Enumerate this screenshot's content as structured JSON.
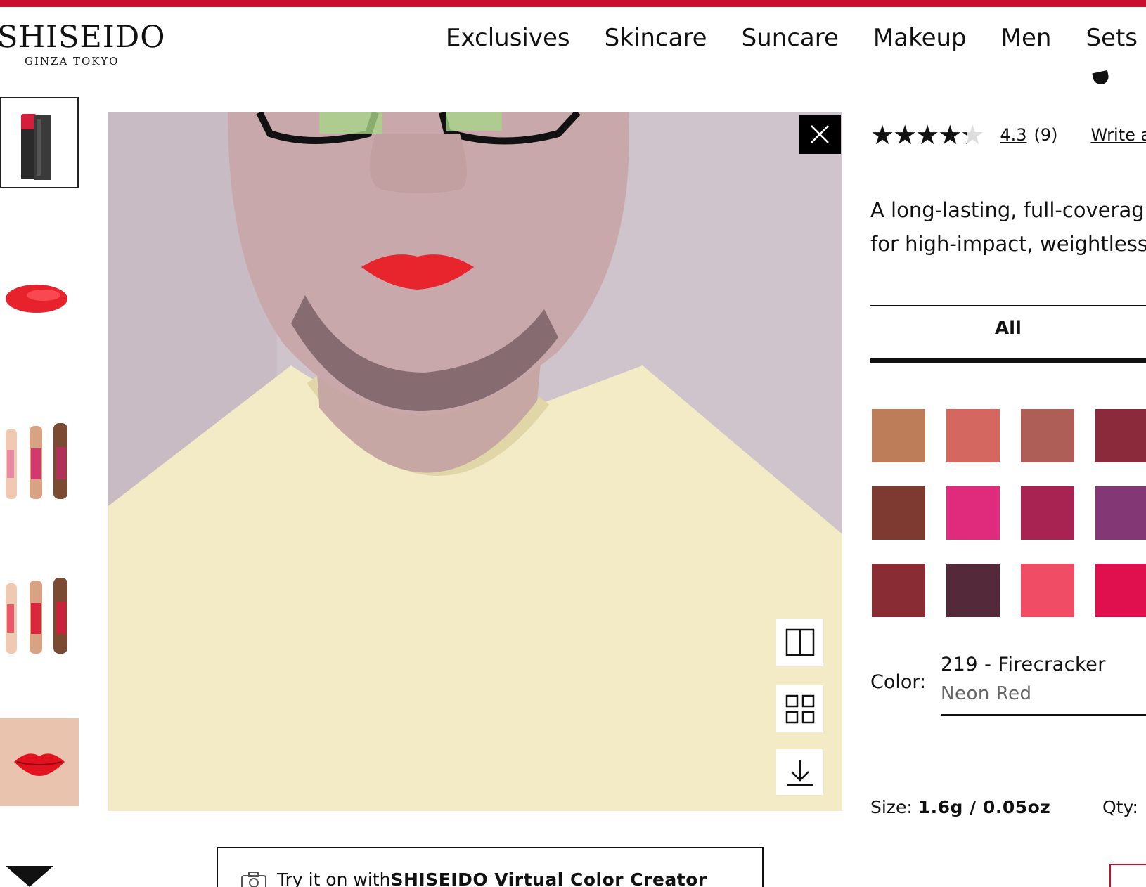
{
  "brand": {
    "logo_word": "SHISEIDO",
    "logo_sub": "GINZA TOKYO",
    "accent": "#c8102e"
  },
  "nav": {
    "items": [
      "Exclusives",
      "Skincare",
      "Suncare",
      "Makeup",
      "Men",
      "Sets"
    ]
  },
  "thumbnails": [
    {
      "icon": "lipstick-product-thumbnail"
    },
    {
      "icon": "lipstick-swatch-smear-thumbnail"
    },
    {
      "icon": "arm-swatches-thumbnail"
    },
    {
      "icon": "arm-swatches-thumbnail"
    },
    {
      "icon": "model-lips-thumbnail"
    }
  ],
  "viewer": {
    "close_icon": "close-icon",
    "tools": [
      "split-view-icon",
      "grid-view-icon",
      "download-icon"
    ]
  },
  "tryon": {
    "prefix": "Try it on with ",
    "brand_text": "SHISEIDO Virtual Color Creator",
    "icon": "camera-icon"
  },
  "product": {
    "rating_value": "4.3",
    "rating_fraction": 0.86,
    "review_count": "(9)",
    "write_review": "Write a",
    "description_lines": [
      "A long-lasting, full-coverag",
      "for high-impact, weightless"
    ],
    "filter_tab": "All",
    "swatch_colors": [
      "#bd7d58",
      "#d4675f",
      "#ae5e57",
      "#8a2a3a",
      "#7e3a30",
      "#e02a7c",
      "#a82252",
      "#843775",
      "#8a2c34",
      "#54293a",
      "#f04c65",
      "#e0104f"
    ],
    "color_label": "Color:",
    "color_name": "219 - Firecracker",
    "color_desc": "Neon Red",
    "size_label": "Size: ",
    "size_value": "1.6g / 0.05oz",
    "qty_label": "Qty:"
  }
}
